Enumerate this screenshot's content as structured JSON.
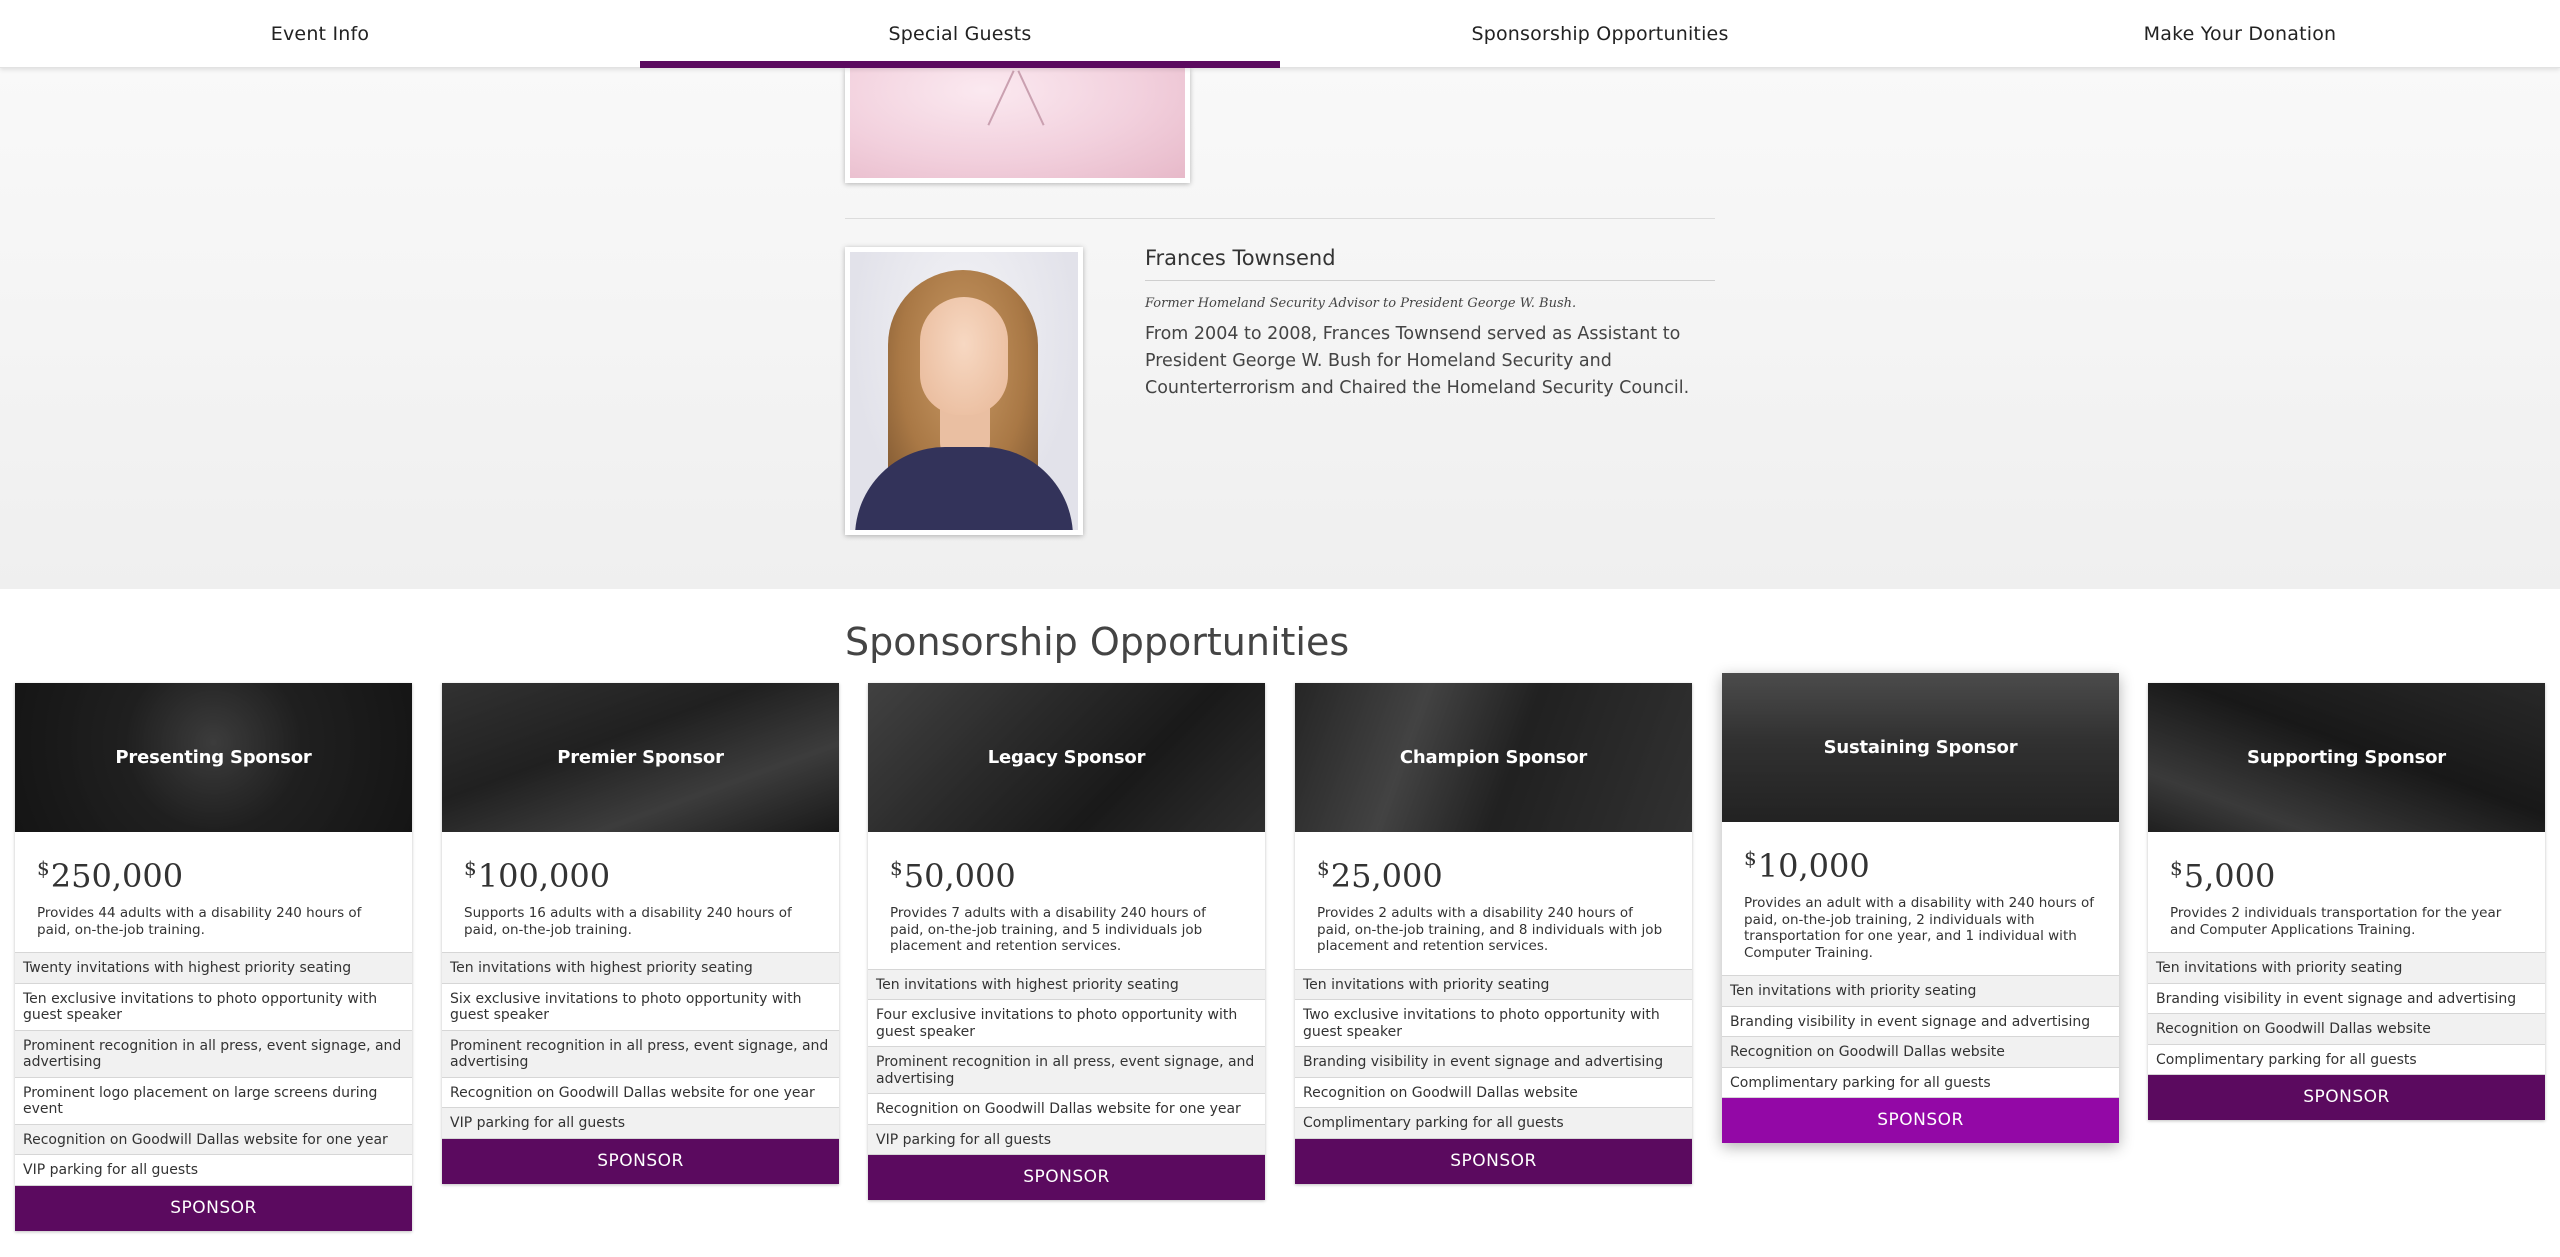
{
  "nav": {
    "items": [
      "Event Info",
      "Special Guests",
      "Sponsorship Opportunities",
      "Make Your Donation"
    ],
    "active": "Special Guests"
  },
  "guest": {
    "name": "Frances Townsend",
    "role": "Former Homeland Security Advisor to President George W. Bush.",
    "bio": "From 2004 to 2008, Frances Townsend served as Assistant to President George W. Bush for Homeland Security and Counterterrorism and Chaired the Homeland Security Council."
  },
  "sponsorship": {
    "title": "Sponsorship Opportunities",
    "button_label": "SPONSOR",
    "currency": "$",
    "cards": [
      {
        "title": "Presenting Sponsor",
        "amount": "250,000",
        "description": "Provides 44 adults with a disability 240 hours of paid, on-the-job training.",
        "benefits": [
          "Twenty invitations with highest priority seating",
          "Ten exclusive invitations to photo opportunity with guest speaker",
          "Prominent recognition in all press, event signage, and advertising",
          "Prominent logo placement on large screens during event",
          "Recognition on Goodwill Dallas website for one year",
          "VIP parking for all guests"
        ]
      },
      {
        "title": "Premier Sponsor",
        "amount": "100,000",
        "description": "Supports 16 adults with a disability 240 hours of paid, on-the-job training.",
        "benefits": [
          "Ten invitations with highest priority seating",
          "Six exclusive invitations to photo opportunity with guest speaker",
          "Prominent recognition in all press, event signage, and advertising",
          "Recognition on Goodwill Dallas website for one year",
          "VIP parking for all guests"
        ]
      },
      {
        "title": "Legacy Sponsor",
        "amount": "50,000",
        "description": "Provides 7 adults with a disability 240 hours of paid, on-the-job training, and 5 individuals job placement and retention services.",
        "benefits": [
          "Ten invitations with highest priority seating",
          "Four exclusive invitations to photo opportunity with guest speaker",
          "Prominent recognition in all press, event signage, and advertising",
          "Recognition on Goodwill Dallas website for one year",
          "VIP parking for all guests"
        ]
      },
      {
        "title": "Champion Sponsor",
        "amount": "25,000",
        "description": "Provides 2 adults with a disability 240 hours of paid, on-the-job training, and 8 individuals with job placement and retention services.",
        "benefits": [
          "Ten invitations with priority seating",
          "Two exclusive invitations to photo opportunity with guest speaker",
          "Branding visibility in event signage and advertising",
          "Recognition on Goodwill Dallas website",
          "Complimentary parking for all guests"
        ]
      },
      {
        "title": "Sustaining Sponsor",
        "amount": "10,000",
        "description": "Provides an adult with a disability with 240 hours of paid, on-the-job training, 2 individuals with transportation for one year, and 1 individual with Computer Training.",
        "benefits": [
          "Ten invitations with priority seating",
          "Branding visibility in event signage and advertising",
          "Recognition on Goodwill Dallas website",
          "Complimentary parking for all guests"
        ]
      },
      {
        "title": "Supporting Sponsor",
        "amount": "5,000",
        "description": "Provides 2 individuals transportation for the year and Computer Applications Training.",
        "benefits": [
          "Ten invitations with priority seating",
          "Branding visibility in event signage and advertising",
          "Recognition on Goodwill Dallas website",
          "Complimentary parking for all guests"
        ]
      }
    ]
  },
  "colors": {
    "brand_purple": "#5b0a5f",
    "hover_purple": "#9308a6"
  }
}
